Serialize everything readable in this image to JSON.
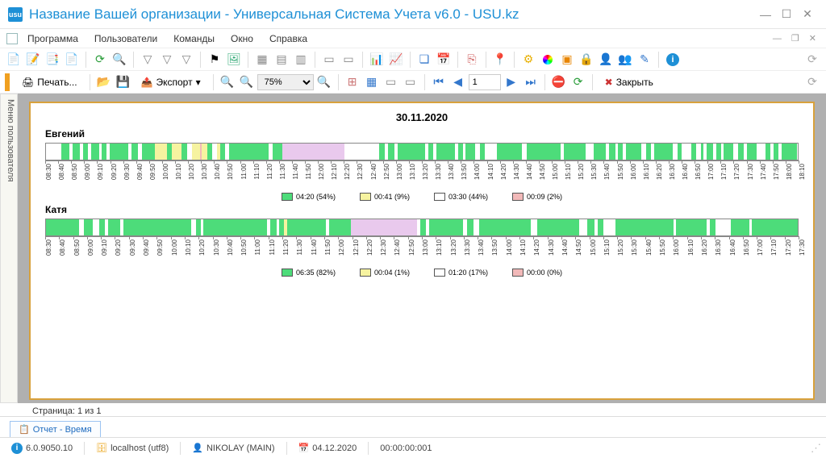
{
  "title": "Название Вашей организации - Универсальная Система Учета v6.0 - USU.kz",
  "menu": {
    "items": [
      "Программа",
      "Пользователи",
      "Команды",
      "Окно",
      "Справка"
    ]
  },
  "toolbar2": {
    "print": "Печать...",
    "export": "Экспорт",
    "zoom": "75%",
    "page_current": "1",
    "close": "Закрыть"
  },
  "side_tab": "Меню пользователя",
  "report": {
    "date": "30.11.2020",
    "page_label": "Страница: 1 из 1"
  },
  "bottom_tab": "Отчет - Время",
  "status": {
    "version": "6.0.9050.10",
    "host": "localhost (utf8)",
    "user": "NIKOLAY (MAIN)",
    "date": "04.12.2020",
    "counter": "00:00:00:001"
  },
  "colors": {
    "active": "#4ddc7a",
    "light_active": "#8fe9a9",
    "idle": "#f6f3a0",
    "break": "#e9c9ed",
    "off": "#ffffff",
    "warn": "#f2b9b9"
  },
  "chart_data": [
    {
      "type": "bar",
      "title": "Евгений",
      "xlabel": "",
      "ylabel": "",
      "x_start": "08:30",
      "x_end": "18:10",
      "ticks": [
        "08:30",
        "08:40",
        "08:50",
        "09:00",
        "09:10",
        "09:20",
        "09:30",
        "09:40",
        "09:50",
        "10:00",
        "10:10",
        "10:20",
        "10:30",
        "10:40",
        "10:50",
        "11:00",
        "11:10",
        "11:20",
        "11:30",
        "11:40",
        "11:50",
        "12:00",
        "12:10",
        "12:20",
        "12:30",
        "12:40",
        "12:50",
        "13:00",
        "13:10",
        "13:20",
        "13:30",
        "13:40",
        "13:50",
        "14:00",
        "14:10",
        "14:20",
        "14:30",
        "14:40",
        "14:50",
        "15:00",
        "15:10",
        "15:20",
        "15:30",
        "15:40",
        "15:50",
        "16:00",
        "16:10",
        "16:20",
        "16:30",
        "16:40",
        "16:50",
        "17:00",
        "17:10",
        "17:20",
        "17:30",
        "17:40",
        "17:50",
        "18:00",
        "18:10"
      ],
      "segments": [
        {
          "state": "off",
          "w": 1
        },
        {
          "state": "active",
          "w": 0.5
        },
        {
          "state": "off",
          "w": 0.2
        },
        {
          "state": "active",
          "w": 0.5
        },
        {
          "state": "off",
          "w": 0.2
        },
        {
          "state": "active",
          "w": 0.3
        },
        {
          "state": "off",
          "w": 0.2
        },
        {
          "state": "active",
          "w": 0.5
        },
        {
          "state": "off",
          "w": 0.2
        },
        {
          "state": "active",
          "w": 0.3
        },
        {
          "state": "off",
          "w": 0.2
        },
        {
          "state": "active",
          "w": 1.2
        },
        {
          "state": "off",
          "w": 0.2
        },
        {
          "state": "active",
          "w": 0.4
        },
        {
          "state": "off",
          "w": 0.3
        },
        {
          "state": "active",
          "w": 0.8
        },
        {
          "state": "idle",
          "w": 0.8
        },
        {
          "state": "active",
          "w": 0.3
        },
        {
          "state": "idle",
          "w": 0.6
        },
        {
          "state": "active",
          "w": 0.4
        },
        {
          "state": "off",
          "w": 0.3
        },
        {
          "state": "idle",
          "w": 0.5
        },
        {
          "state": "warn",
          "w": 0.1
        },
        {
          "state": "idle",
          "w": 0.4
        },
        {
          "state": "active",
          "w": 0.3
        },
        {
          "state": "off",
          "w": 0.3
        },
        {
          "state": "idle",
          "w": 0.2
        },
        {
          "state": "active",
          "w": 0.3
        },
        {
          "state": "off",
          "w": 0.3
        },
        {
          "state": "active",
          "w": 2.5
        },
        {
          "state": "off",
          "w": 0.3
        },
        {
          "state": "active",
          "w": 0.6
        },
        {
          "state": "break",
          "w": 4
        },
        {
          "state": "off",
          "w": 2.2
        },
        {
          "state": "active",
          "w": 0.4
        },
        {
          "state": "off",
          "w": 0.2
        },
        {
          "state": "active",
          "w": 0.4
        },
        {
          "state": "off",
          "w": 0.2
        },
        {
          "state": "active",
          "w": 1.8
        },
        {
          "state": "off",
          "w": 0.2
        },
        {
          "state": "active",
          "w": 0.3
        },
        {
          "state": "off",
          "w": 0.2
        },
        {
          "state": "active",
          "w": 1.2
        },
        {
          "state": "off",
          "w": 0.2
        },
        {
          "state": "active",
          "w": 0.3
        },
        {
          "state": "off",
          "w": 0.2
        },
        {
          "state": "active",
          "w": 0.6
        },
        {
          "state": "off",
          "w": 0.3
        },
        {
          "state": "active",
          "w": 0.3
        },
        {
          "state": "off",
          "w": 0.8
        },
        {
          "state": "active",
          "w": 1.6
        },
        {
          "state": "off",
          "w": 0.3
        },
        {
          "state": "active",
          "w": 2.2
        },
        {
          "state": "off",
          "w": 0.2
        },
        {
          "state": "active",
          "w": 1.4
        },
        {
          "state": "off",
          "w": 0.5
        },
        {
          "state": "active",
          "w": 0.8
        },
        {
          "state": "off",
          "w": 0.2
        },
        {
          "state": "active",
          "w": 0.4
        },
        {
          "state": "off",
          "w": 0.2
        },
        {
          "state": "active",
          "w": 0.3
        },
        {
          "state": "off",
          "w": 0.2
        },
        {
          "state": "active",
          "w": 1.0
        },
        {
          "state": "off",
          "w": 0.3
        },
        {
          "state": "active",
          "w": 0.3
        },
        {
          "state": "off",
          "w": 0.2
        },
        {
          "state": "active",
          "w": 1.2
        },
        {
          "state": "off",
          "w": 0.3
        },
        {
          "state": "active",
          "w": 0.3
        },
        {
          "state": "off",
          "w": 0.6
        },
        {
          "state": "active",
          "w": 0.3
        },
        {
          "state": "off",
          "w": 0.3
        },
        {
          "state": "active",
          "w": 0.2
        },
        {
          "state": "off",
          "w": 0.2
        },
        {
          "state": "active",
          "w": 0.4
        },
        {
          "state": "off",
          "w": 0.2
        },
        {
          "state": "active",
          "w": 0.3
        },
        {
          "state": "off",
          "w": 0.2
        },
        {
          "state": "active",
          "w": 0.6
        },
        {
          "state": "off",
          "w": 0.3
        },
        {
          "state": "active",
          "w": 0.4
        },
        {
          "state": "off",
          "w": 0.2
        },
        {
          "state": "active",
          "w": 0.6
        },
        {
          "state": "off",
          "w": 0.6
        },
        {
          "state": "active",
          "w": 0.3
        },
        {
          "state": "off",
          "w": 0.2
        },
        {
          "state": "active",
          "w": 0.3
        },
        {
          "state": "off",
          "w": 0.2
        },
        {
          "state": "active",
          "w": 1.0
        }
      ],
      "legend": [
        {
          "color": "active",
          "label": "04:20 (54%)"
        },
        {
          "color": "idle",
          "label": "00:41 (9%)"
        },
        {
          "color": "off",
          "label": "03:30 (44%)"
        },
        {
          "color": "warn",
          "label": "00:09 (2%)"
        }
      ]
    },
    {
      "type": "bar",
      "title": "Катя",
      "xlabel": "",
      "ylabel": "",
      "x_start": "08:30",
      "x_end": "17:30",
      "ticks": [
        "08:30",
        "08:40",
        "08:50",
        "09:00",
        "09:10",
        "09:20",
        "09:30",
        "09:40",
        "09:50",
        "10:00",
        "10:10",
        "10:20",
        "10:30",
        "10:40",
        "10:50",
        "11:00",
        "11:10",
        "11:20",
        "11:30",
        "11:40",
        "11:50",
        "12:00",
        "12:10",
        "12:20",
        "12:30",
        "12:40",
        "12:50",
        "13:00",
        "13:10",
        "13:20",
        "13:30",
        "13:40",
        "13:50",
        "14:00",
        "14:10",
        "14:20",
        "14:30",
        "14:40",
        "14:50",
        "15:00",
        "15:10",
        "15:20",
        "15:30",
        "15:40",
        "15:50",
        "16:00",
        "16:10",
        "16:20",
        "16:30",
        "16:40",
        "16:50",
        "17:00",
        "17:10",
        "17:20",
        "17:30"
      ],
      "segments": [
        {
          "state": "active",
          "w": 2.2
        },
        {
          "state": "off",
          "w": 0.3
        },
        {
          "state": "active",
          "w": 0.6
        },
        {
          "state": "off",
          "w": 0.4
        },
        {
          "state": "active",
          "w": 0.4
        },
        {
          "state": "off",
          "w": 0.2
        },
        {
          "state": "active",
          "w": 0.8
        },
        {
          "state": "off",
          "w": 0.2
        },
        {
          "state": "active",
          "w": 4.5
        },
        {
          "state": "off",
          "w": 0.3
        },
        {
          "state": "active",
          "w": 0.3
        },
        {
          "state": "off",
          "w": 0.2
        },
        {
          "state": "active",
          "w": 4.2
        },
        {
          "state": "off",
          "w": 0.2
        },
        {
          "state": "active",
          "w": 0.4
        },
        {
          "state": "off",
          "w": 0.2
        },
        {
          "state": "active",
          "w": 0.3
        },
        {
          "state": "idle",
          "w": 0.2
        },
        {
          "state": "active",
          "w": 2.6
        },
        {
          "state": "off",
          "w": 0.2
        },
        {
          "state": "active",
          "w": 1.4
        },
        {
          "state": "break",
          "w": 4.4
        },
        {
          "state": "off",
          "w": 0.2
        },
        {
          "state": "active",
          "w": 0.4
        },
        {
          "state": "off",
          "w": 0.2
        },
        {
          "state": "active",
          "w": 2.2
        },
        {
          "state": "off",
          "w": 0.3
        },
        {
          "state": "active",
          "w": 0.4
        },
        {
          "state": "off",
          "w": 0.4
        },
        {
          "state": "active",
          "w": 3.4
        },
        {
          "state": "off",
          "w": 0.4
        },
        {
          "state": "active",
          "w": 2.8
        },
        {
          "state": "off",
          "w": 0.5
        },
        {
          "state": "active",
          "w": 0.5
        },
        {
          "state": "off",
          "w": 0.2
        },
        {
          "state": "active",
          "w": 0.4
        },
        {
          "state": "off",
          "w": 0.8
        },
        {
          "state": "active",
          "w": 3.8
        },
        {
          "state": "off",
          "w": 0.2
        },
        {
          "state": "active",
          "w": 2.0
        },
        {
          "state": "off",
          "w": 0.2
        },
        {
          "state": "active",
          "w": 0.4
        },
        {
          "state": "off",
          "w": 1.0
        },
        {
          "state": "active",
          "w": 1.2
        },
        {
          "state": "off",
          "w": 0.2
        },
        {
          "state": "active",
          "w": 3.0
        }
      ],
      "legend": [
        {
          "color": "active",
          "label": "06:35 (82%)"
        },
        {
          "color": "idle",
          "label": "00:04 (1%)"
        },
        {
          "color": "off",
          "label": "01:20 (17%)"
        },
        {
          "color": "warn",
          "label": "00:00 (0%)"
        }
      ]
    }
  ]
}
